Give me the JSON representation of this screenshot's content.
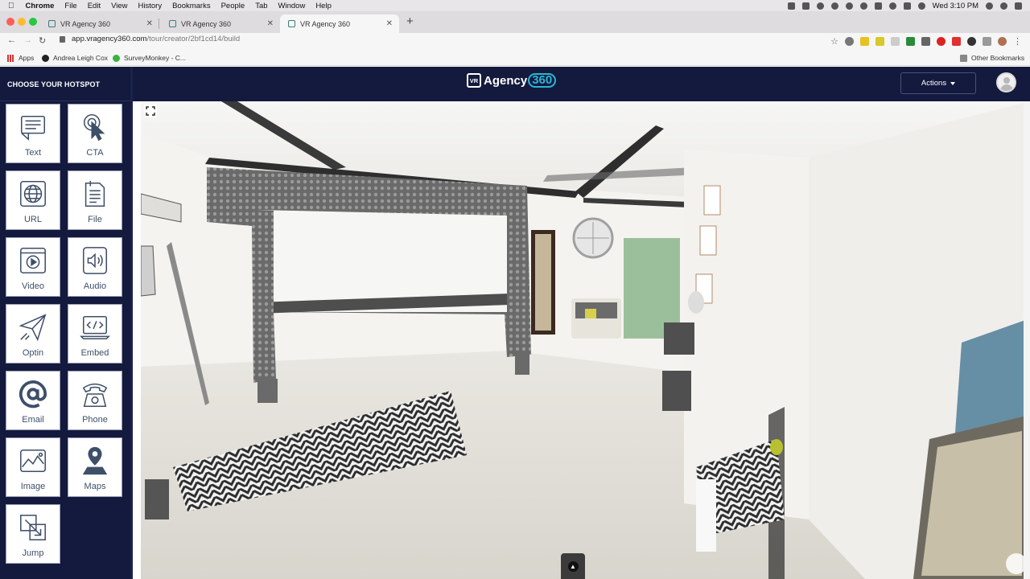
{
  "os_menubar": {
    "app": "Chrome",
    "items": [
      "File",
      "Edit",
      "View",
      "History",
      "Bookmarks",
      "People",
      "Tab",
      "Window",
      "Help"
    ],
    "clock": "Wed 3:10 PM"
  },
  "browser": {
    "tabs": [
      {
        "title": "VR Agency 360",
        "active": false
      },
      {
        "title": "VR Agency 360",
        "active": false
      },
      {
        "title": "VR Agency 360",
        "active": true
      }
    ],
    "url_host": "app.vragency360.com",
    "url_path": "/tour/creator/2bf1cd14/build",
    "bookmarks": [
      "Apps",
      "Andrea Leigh Cox",
      "SurveyMonkey - C..."
    ],
    "other_bookmarks": "Other Bookmarks"
  },
  "header": {
    "logo_vr": "VR",
    "logo_name": "Agency",
    "logo_num": "360",
    "actions_label": "Actions"
  },
  "sidebar": {
    "title": "CHOOSE YOUR HOTSPOT",
    "hotspots": [
      {
        "label": "Text",
        "icon": "text-icon"
      },
      {
        "label": "CTA",
        "icon": "pointer-click-icon"
      },
      {
        "label": "URL",
        "icon": "globe-icon"
      },
      {
        "label": "File",
        "icon": "file-icon"
      },
      {
        "label": "Video",
        "icon": "video-icon"
      },
      {
        "label": "Audio",
        "icon": "audio-icon"
      },
      {
        "label": "Optin",
        "icon": "paper-plane-icon"
      },
      {
        "label": "Embed",
        "icon": "code-icon"
      },
      {
        "label": "Email",
        "icon": "at-sign-icon"
      },
      {
        "label": "Phone",
        "icon": "phone-icon"
      },
      {
        "label": "Image",
        "icon": "image-icon"
      },
      {
        "label": "Maps",
        "icon": "map-pin-icon"
      },
      {
        "label": "Jump",
        "icon": "jump-icon"
      }
    ]
  },
  "colors": {
    "navy": "#141a3d",
    "accent": "#29b6d6",
    "icon_stroke": "#3e4f68"
  }
}
